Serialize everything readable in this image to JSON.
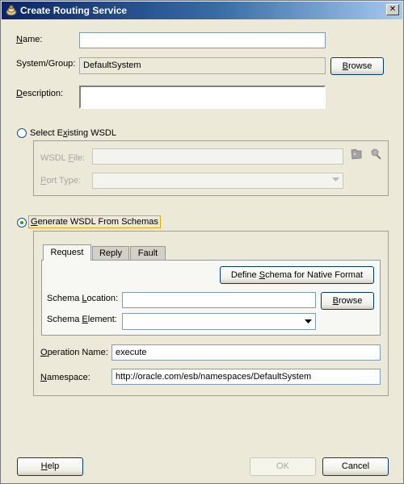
{
  "window": {
    "title": "Create Routing Service",
    "close_glyph": "✕"
  },
  "form": {
    "name": {
      "label_pre": "",
      "label_key": "N",
      "label_post": "ame:",
      "value": ""
    },
    "system_group": {
      "label": "System/Group:",
      "value": "DefaultSystem",
      "button_pre": "",
      "button_key": "B",
      "button_post": "rowse"
    },
    "description": {
      "label_pre": "",
      "label_key": "D",
      "label_post": "escription:",
      "value": ""
    }
  },
  "existing_wsdl": {
    "radio_pre": "Select E",
    "radio_key": "x",
    "radio_post": "isting WSDL",
    "selected": false,
    "wsdl_file": {
      "label_pre": "WSDL ",
      "label_key": "F",
      "label_post": "ile:",
      "value": ""
    },
    "port_type": {
      "label_pre": "",
      "label_key": "P",
      "label_post": "ort Type:",
      "value": ""
    },
    "icons": [
      "wsdl-browse-icon",
      "service-explorer-icon"
    ]
  },
  "generate_wsdl": {
    "radio_pre": "",
    "radio_key": "G",
    "radio_post": "enerate WSDL From Schemas",
    "selected": true,
    "tabs": [
      {
        "label": "Request",
        "active": true
      },
      {
        "label": "Reply",
        "active": false
      },
      {
        "label": "Fault",
        "active": false
      }
    ],
    "define_schema_button": {
      "pre": "Define ",
      "key": "S",
      "post": "chema for Native Format"
    },
    "schema_location": {
      "label_pre": "Schema ",
      "label_key": "L",
      "label_post": "ocation:",
      "value": "",
      "button_pre": "",
      "button_key": "B",
      "button_post": "rowse"
    },
    "schema_element": {
      "label_pre": "Schema ",
      "label_key": "E",
      "label_post": "lement:",
      "value": ""
    },
    "operation_name": {
      "label_pre": "",
      "label_key": "O",
      "label_post": "peration Name:",
      "value": "execute"
    },
    "namespace": {
      "label_pre": "",
      "label_key": "N",
      "label_post": "amespace:",
      "value": "http://oracle.com/esb/namespaces/DefaultSystem"
    }
  },
  "footer": {
    "help": {
      "pre": "",
      "key": "H",
      "post": "elp"
    },
    "ok": "OK",
    "cancel": "Cancel"
  },
  "colors": {
    "dialog_bg": "#ece9d8",
    "title_gradient_start": "#0a246a",
    "title_gradient_end": "#a6caf0",
    "focus_outline": "#e8a600",
    "radio_dot": "#21a121"
  }
}
